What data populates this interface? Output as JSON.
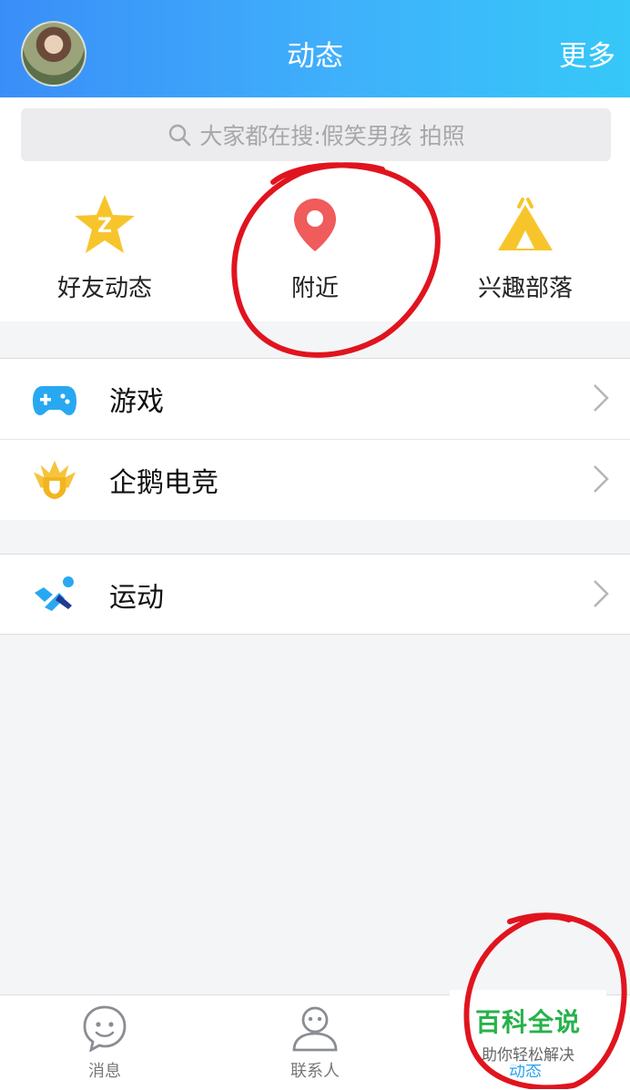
{
  "header": {
    "title": "动态",
    "more_label": "更多"
  },
  "search": {
    "placeholder": "大家都在搜:假笑男孩 拍照"
  },
  "quick_links": [
    {
      "label": "好友动态",
      "icon": "qzone-star-icon"
    },
    {
      "label": "附近",
      "icon": "location-pin-icon"
    },
    {
      "label": "兴趣部落",
      "icon": "tent-icon"
    }
  ],
  "group1": [
    {
      "label": "游戏",
      "icon": "gamepad-icon"
    },
    {
      "label": "企鹅电竞",
      "icon": "esports-badge-icon"
    }
  ],
  "group2": [
    {
      "label": "运动",
      "icon": "running-icon"
    }
  ],
  "tabs": [
    {
      "label": "消息",
      "icon": "chat-bubble-icon"
    },
    {
      "label": "联系人",
      "icon": "contact-person-icon"
    },
    {
      "label": "动态",
      "icon": "star-icon",
      "active": true
    }
  ],
  "watermark": {
    "title": "百科全说",
    "subtitle": "助你轻松解决"
  },
  "colors": {
    "accent": "#2aa3f5",
    "header_start": "#3a8ef8",
    "header_end": "#36c8f8",
    "annotation": "#e0141e"
  }
}
